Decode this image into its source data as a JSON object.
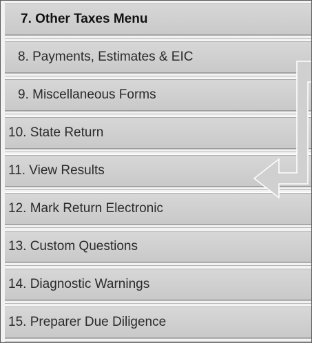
{
  "menu": {
    "items": [
      {
        "label": "7. Other Taxes Menu",
        "active": true
      },
      {
        "label": "8. Payments, Estimates & EIC"
      },
      {
        "label": "9. Miscellaneous Forms"
      },
      {
        "label": "10. State Return"
      },
      {
        "label": "11. View Results"
      },
      {
        "label": "12. Mark Return Electronic"
      },
      {
        "label": "13. Custom Questions"
      },
      {
        "label": "14. Diagnostic Warnings"
      },
      {
        "label": "15. Preparer Due Diligence"
      }
    ]
  },
  "annotation": {
    "icon": "arrow-down-left-icon",
    "color": "#cfcfcf"
  }
}
